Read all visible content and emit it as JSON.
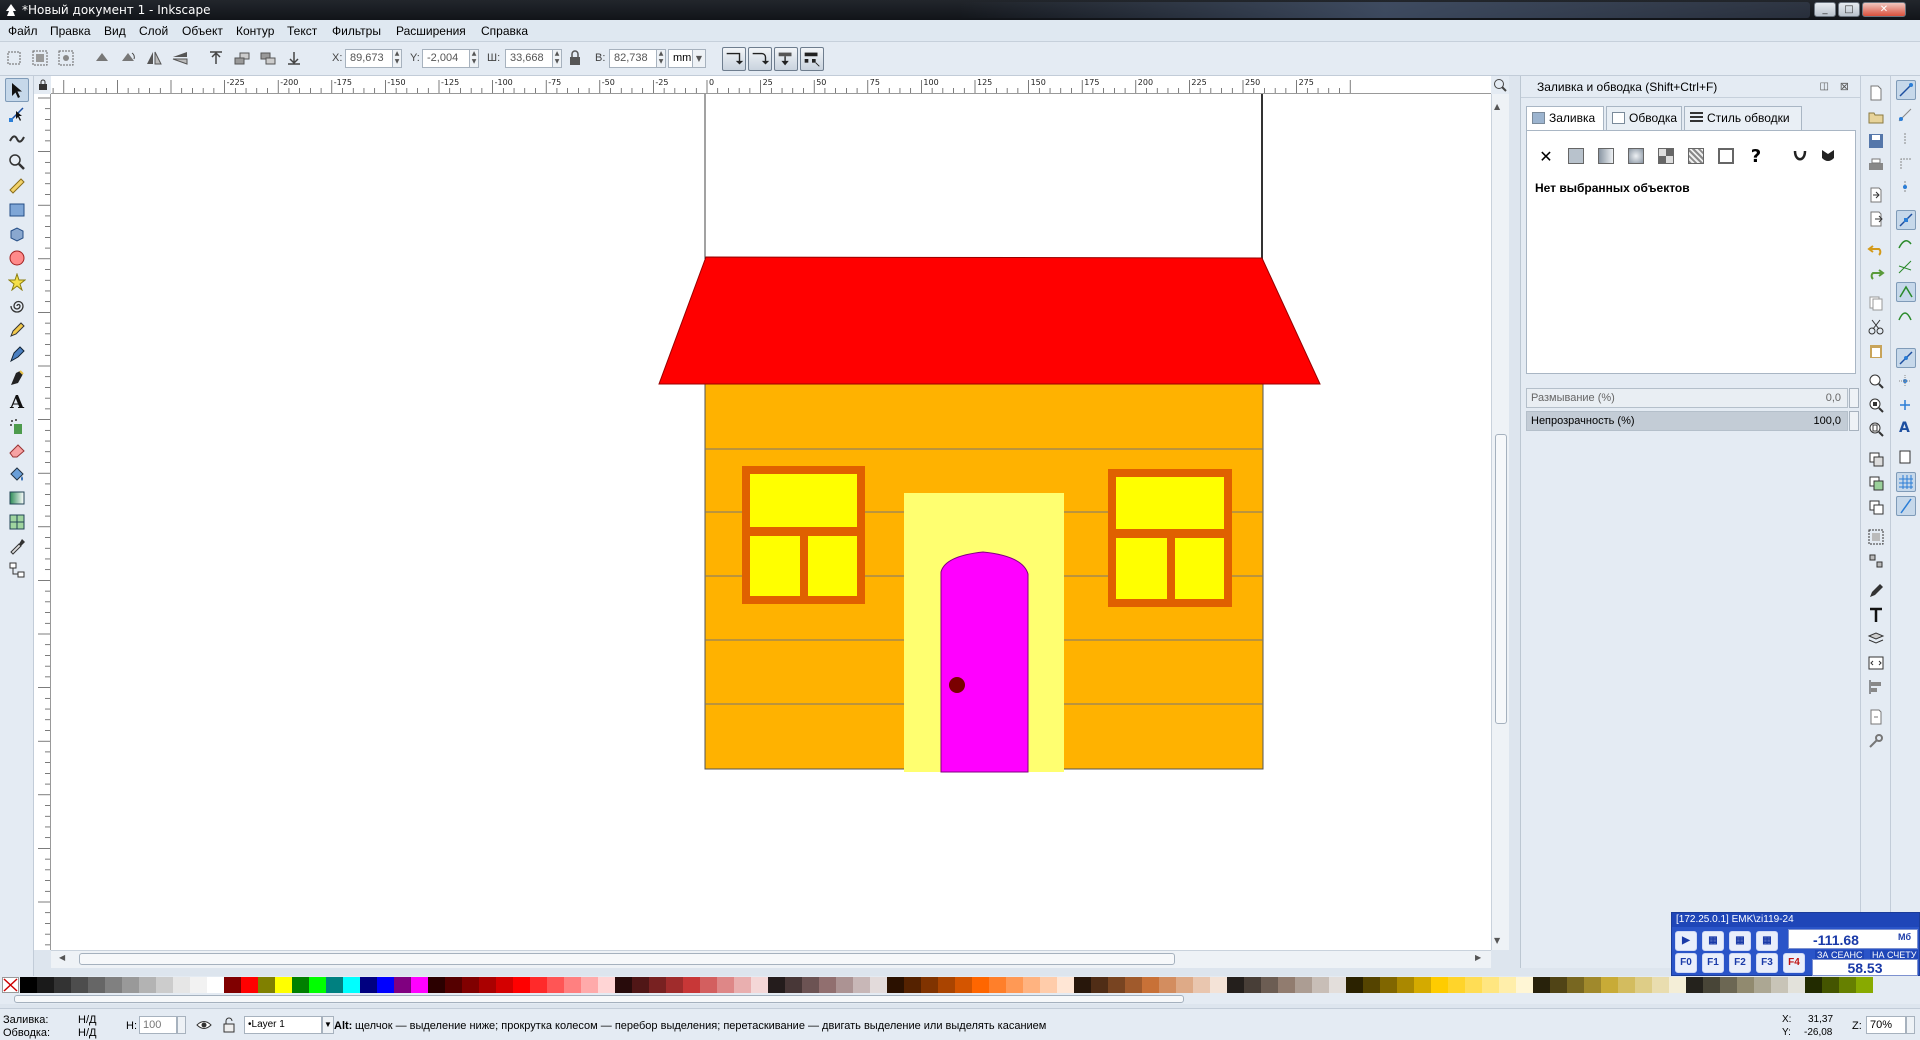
{
  "window": {
    "title": "*Новый документ 1 - Inkscape"
  },
  "menu": [
    "Файл",
    "Правка",
    "Вид",
    "Слой",
    "Объект",
    "Контур",
    "Текст",
    "Фильтры",
    "Расширения",
    "Справка"
  ],
  "toolctrl": {
    "x_label": "X:",
    "x_value": "89,673",
    "y_label": "Y:",
    "y_value": "-2,004",
    "w_label": "Ш:",
    "w_value": "33,668",
    "h_label": "В:",
    "h_value": "82,738",
    "unit": "mm"
  },
  "ruler": {
    "h_labels": [
      "-225",
      "-200",
      "-175",
      "-150",
      "-125",
      "-100",
      "-75",
      "-50",
      "-25",
      "0",
      "25",
      "50",
      "75",
      "100",
      "125",
      "150",
      "175",
      "200",
      "225",
      "250",
      "275"
    ]
  },
  "dock": {
    "title": "Заливка и обводка (Shift+Ctrl+F)",
    "tabs": [
      "Заливка",
      "Обводка",
      "Стиль обводки"
    ],
    "no_selection": "Нет выбранных объектов",
    "blur_label": "Размывание (%)",
    "blur_value": "0,0",
    "opacity_label": "Непрозрачность (%)",
    "opacity_value": "100,0",
    "opacity_fill": 1.0
  },
  "drawing": {
    "roof_color": "#ff0000",
    "wall_color": "#ffb200",
    "window_frame_color": "#e06000",
    "window_glass_color": "#ffff00",
    "door_frame_color": "#ffff70",
    "door_color": "#ff00ff",
    "knob_color": "#7a0000"
  },
  "statusbar": {
    "fill_label": "Заливка:",
    "fill_value": "Н/Д",
    "stroke_label": "Обводка:",
    "stroke_value": "Н/Д",
    "h_label": "H:",
    "h_value": "100",
    "layer": "•Layer 1",
    "hint_key": "Alt:",
    "hint": "щелчок — выделение ниже; прокрутка колесом — перебор выделения; перетаскивание — двигать выделение или выделять касанием",
    "x_label": "X:",
    "x_coord": "31,37",
    "y_label": "Y:",
    "y_coord": "-26,08",
    "zoom_label": "Z:",
    "zoom": "70%"
  },
  "widget": {
    "header": "[172.25.0.1] EMK\\zi119-24",
    "value1": "-111.68",
    "value1_unit": "Мб",
    "label_session": "ЗА СЕАНС",
    "label_account": "НА СЧЕТУ",
    "value2": "58.53",
    "fkeys": [
      "F0",
      "F1",
      "F2",
      "F3",
      "F4"
    ]
  },
  "palette_colors": [
    "#000000",
    "#1a1a1a",
    "#333333",
    "#4d4d4d",
    "#666666",
    "#808080",
    "#999999",
    "#b3b3b3",
    "#cccccc",
    "#e6e6e6",
    "#f2f2f2",
    "#ffffff",
    "#800000",
    "#ff0000",
    "#808000",
    "#ffff00",
    "#008000",
    "#00ff00",
    "#008080",
    "#00ffff",
    "#000080",
    "#0000ff",
    "#800080",
    "#ff00ff",
    "#2b0000",
    "#550000",
    "#800000",
    "#aa0000",
    "#d40000",
    "#ff0000",
    "#ff2a2a",
    "#ff5555",
    "#ff8080",
    "#ffaaaa",
    "#ffd5d5",
    "#280b0b",
    "#501616",
    "#782121",
    "#a02c2c",
    "#c83737",
    "#d35f5f",
    "#de8787",
    "#e9afaf",
    "#f4d7d7",
    "#241c1c",
    "#483737",
    "#6c5353",
    "#916f6f",
    "#ac9393",
    "#c8b7b7",
    "#e3dbdb",
    "#2b1100",
    "#552200",
    "#803300",
    "#aa4400",
    "#d45500",
    "#ff6600",
    "#ff7f2a",
    "#ff9955",
    "#ffb380",
    "#ffccaa",
    "#ffe6d5",
    "#28170b",
    "#502d16",
    "#784421",
    "#a05a2c",
    "#c87137",
    "#d38d5f",
    "#deaa87",
    "#e9c6af",
    "#f4e3d7",
    "#241f1c",
    "#483e37",
    "#6c5d53",
    "#917c6f",
    "#ac9d93",
    "#c8beb7",
    "#e3dedb",
    "#2b2200",
    "#554400",
    "#806600",
    "#aa8800",
    "#d4aa00",
    "#ffcc00",
    "#ffd42a",
    "#ffdd55",
    "#ffe680",
    "#ffeeaa",
    "#fff6d5",
    "#28220b",
    "#504416",
    "#786721",
    "#a0892c",
    "#c8ab37",
    "#d3bc5f",
    "#decd87",
    "#e9ddaf",
    "#f4eed7",
    "#24221c",
    "#484537",
    "#6c6753",
    "#918a6f",
    "#aca793",
    "#c8c4b7",
    "#e3e2db",
    "#222b00",
    "#445500",
    "#668000",
    "#88aa00"
  ]
}
